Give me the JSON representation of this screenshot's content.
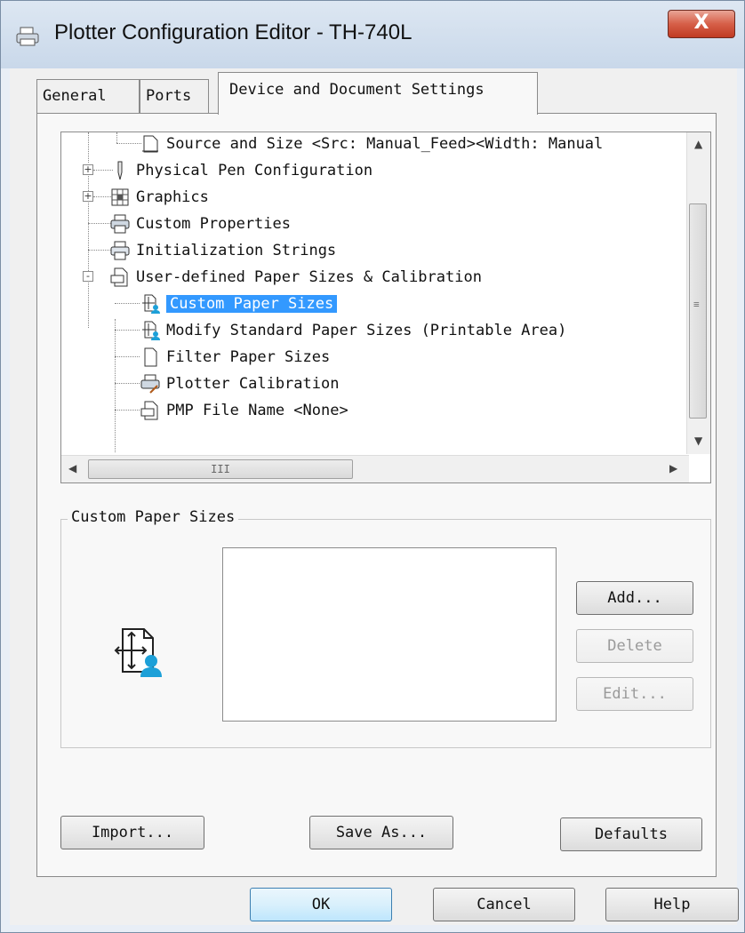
{
  "window": {
    "title": "Plotter Configuration Editor - TH-740L",
    "close_label": "X"
  },
  "tabs": [
    {
      "label": "General",
      "active": false
    },
    {
      "label": "Ports",
      "active": false
    },
    {
      "label": "Device and Document Settings",
      "active": true
    }
  ],
  "tree": {
    "items": [
      {
        "label": "Source and Size <Src:  Manual_Feed><Width: Manual",
        "icon": "paper-size-icon",
        "expander": ""
      },
      {
        "label": "Physical Pen Configuration",
        "icon": "pen-icon",
        "expander": "+"
      },
      {
        "label": "Graphics",
        "icon": "graphics-icon",
        "expander": "+"
      },
      {
        "label": "Custom Properties",
        "icon": "printer-properties-icon",
        "expander": ""
      },
      {
        "label": "Initialization Strings",
        "icon": "printer-strings-icon",
        "expander": ""
      },
      {
        "label": "User-defined Paper Sizes & Calibration",
        "icon": "paper-calibration-icon",
        "expander": "-"
      },
      {
        "label": "Custom Paper Sizes",
        "icon": "custom-paper-icon",
        "selected": true
      },
      {
        "label": "Modify Standard Paper Sizes (Printable Area)",
        "icon": "modify-paper-icon"
      },
      {
        "label": "Filter Paper Sizes",
        "icon": "filter-paper-icon"
      },
      {
        "label": "Plotter Calibration",
        "icon": "plotter-calibration-icon"
      },
      {
        "label": "PMP File Name <None>",
        "icon": "pmp-file-icon"
      }
    ],
    "hscroll_grip": "III"
  },
  "group": {
    "label": "Custom Paper Sizes",
    "add_label": "Add...",
    "delete_label": "Delete",
    "edit_label": "Edit..."
  },
  "panel_buttons": {
    "import_label": "Import...",
    "saveas_label": "Save As...",
    "defaults_label": "Defaults"
  },
  "dialog_buttons": {
    "ok_label": "OK",
    "cancel_label": "Cancel",
    "help_label": "Help"
  }
}
